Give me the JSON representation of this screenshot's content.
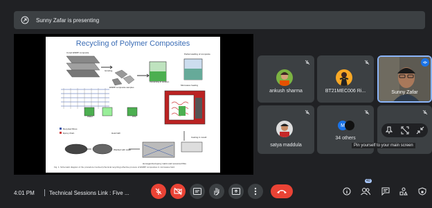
{
  "banner": {
    "text": "Sunny Zafar is presenting"
  },
  "slide": {
    "title": "Recycling of Polymer Composites",
    "labels": {
      "cured": "Cured EMMP composite",
      "grinding": "Grinding",
      "partial": "Partial swelling of composite",
      "ground": "EMMP composite samples",
      "immersing": "Immersing in solution",
      "microwave": "Microwave heating",
      "water": "Water",
      "ppf": "PPF",
      "fibre": "Recycled fibres",
      "epoxy": "Epoxy chain",
      "heat": "Heat bath",
      "matrix": "Homogenized epoxy matrix and recovered fibre",
      "casting": "Casting in mould",
      "washed": "Washed with water"
    },
    "caption": "Fig. 1. Schematic diagram of the procedure involved (chemical recycling) effective process of EMMP composites in microwave field."
  },
  "participants": [
    {
      "name": "ankush sharma",
      "id": "p1"
    },
    {
      "name": "BT21MEC006 Ri...",
      "id": "p2"
    },
    {
      "name": "Sunny Zafar",
      "id": "p3"
    },
    {
      "name": "satya maddula",
      "id": "p4"
    },
    {
      "name": "34 others",
      "id": "p5",
      "initial": "M"
    }
  ],
  "tooltip": "Pin yourself to your main screen",
  "bottom": {
    "time": "4:01 PM",
    "meeting": "Technical Sessions Link : Five ...",
    "people_count": "40"
  },
  "colors": {
    "end_call": "#ea4335",
    "bg": "#202124",
    "tile": "#3c4043",
    "accent": "#8ab4f8"
  }
}
